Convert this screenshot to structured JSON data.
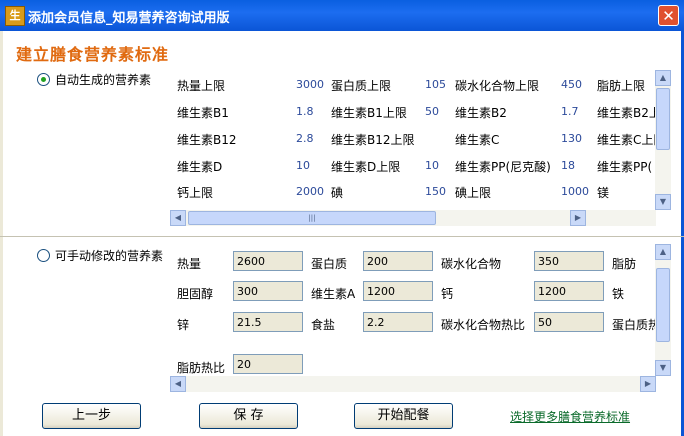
{
  "window": {
    "title": "添加会员信息_知易营养咨询试用版",
    "close_label": "✕",
    "icon_label": "生"
  },
  "heading": "建立膳食营养素标准",
  "auto_section": {
    "radio_label": "自动生成的营养素",
    "rows": [
      [
        {
          "label": "热量上限",
          "value": "3000"
        },
        {
          "label": "蛋白质上限",
          "value": "105"
        },
        {
          "label": "碳水化合物上限",
          "value": "450"
        },
        {
          "label": "脂肪上限",
          "value": ""
        }
      ],
      [
        {
          "label": "维生素B1",
          "value": "1.8"
        },
        {
          "label": "维生素B1上限",
          "value": "50"
        },
        {
          "label": "维生素B2",
          "value": "1.7"
        },
        {
          "label": "维生素B2上",
          "value": ""
        }
      ],
      [
        {
          "label": "维生素B12",
          "value": "2.8"
        },
        {
          "label": "维生素B12上限",
          "value": ""
        },
        {
          "label": "维生素C",
          "value": "130"
        },
        {
          "label": "维生素C上限",
          "value": ""
        }
      ],
      [
        {
          "label": "维生素D",
          "value": "10"
        },
        {
          "label": "维生素D上限",
          "value": "10"
        },
        {
          "label": "维生素PP(尼克酸)",
          "value": "18"
        },
        {
          "label": "维生素PP(",
          "value": ""
        }
      ],
      [
        {
          "label": "钙上限",
          "value": "2000"
        },
        {
          "label": "碘",
          "value": "150"
        },
        {
          "label": "碘上限",
          "value": "1000"
        },
        {
          "label": "镁",
          "value": ""
        }
      ]
    ]
  },
  "manual_section": {
    "radio_label": "可手动修改的营养素",
    "rows": [
      [
        {
          "label": "热量",
          "value": "2600"
        },
        {
          "label": "蛋白质",
          "value": "200"
        },
        {
          "label": "碳水化合物",
          "value": "350"
        },
        {
          "label": "脂肪",
          "value": ""
        }
      ],
      [
        {
          "label": "胆固醇",
          "value": "300"
        },
        {
          "label": "维生素A",
          "value": "1200"
        },
        {
          "label": "钙",
          "value": "1200"
        },
        {
          "label": "铁",
          "value": ""
        }
      ],
      [
        {
          "label": "锌",
          "value": "21.5"
        },
        {
          "label": "食盐",
          "value": "2.2"
        },
        {
          "label": "碳水化合物热比",
          "value": "50"
        },
        {
          "label": "蛋白质热",
          "value": ""
        }
      ],
      [
        {
          "label": "脂肪热比",
          "value": "20"
        }
      ]
    ]
  },
  "buttons": {
    "prev": "上一步",
    "save": "保 存",
    "start": "开始配餐"
  },
  "link": "选择更多膳食营养标准",
  "scroll_glyphs": {
    "up": "▲",
    "down": "▼",
    "left": "◀",
    "right": "▶",
    "grip": "|||"
  },
  "colors": {
    "heading": "#e06a10",
    "value_text": "#2c4a9a",
    "titlebar": "#0a5fe0"
  }
}
